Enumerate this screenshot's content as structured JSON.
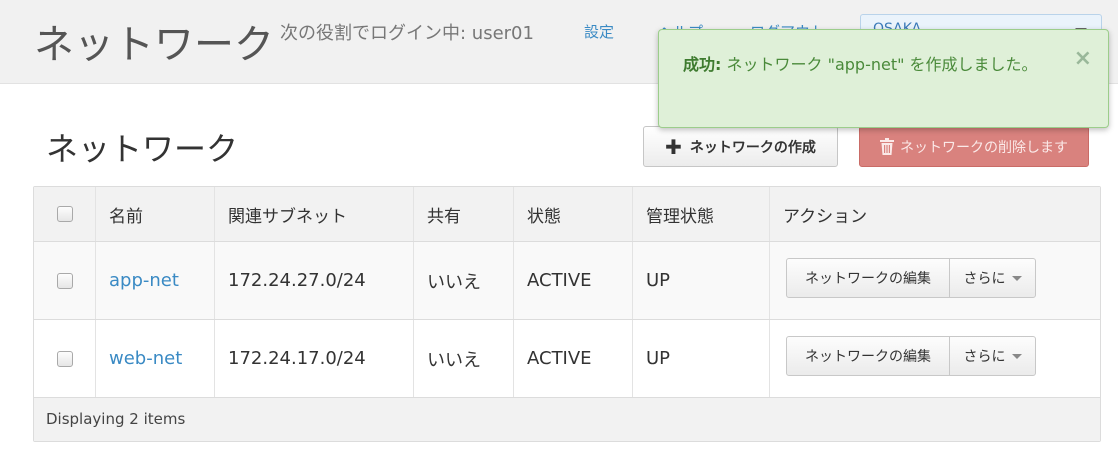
{
  "header": {
    "brand": "ネットワーク",
    "login_info": "次の役割でログイン中: user01",
    "links": {
      "settings": "設定",
      "help": "ヘルプ",
      "logout": "ログアウト"
    },
    "region": "OSAKA"
  },
  "page": {
    "title": "ネットワーク",
    "create_button": "ネットワークの作成",
    "delete_button": "ネットワークの削除します"
  },
  "table": {
    "columns": [
      "名前",
      "関連サブネット",
      "共有",
      "状態",
      "管理状態",
      "アクション"
    ],
    "rows": [
      {
        "name": "app-net",
        "subnet": "172.24.27.0/24",
        "shared": "いいえ",
        "status": "ACTIVE",
        "admin_state": "UP",
        "edit_label": "ネットワークの編集",
        "more_label": "さらに"
      },
      {
        "name": "web-net",
        "subnet": "172.24.17.0/24",
        "shared": "いいえ",
        "status": "ACTIVE",
        "admin_state": "UP",
        "edit_label": "ネットワークの編集",
        "more_label": "さらに"
      }
    ],
    "footer": "Displaying 2 items"
  },
  "toast": {
    "prefix": "成功:",
    "message": "ネットワーク \"app-net\" を作成しました。",
    "close": "×"
  },
  "colors": {
    "accent_link": "#3a8ac4",
    "danger": "#d9827e",
    "success_bg": "#dff0d8"
  },
  "icons": [
    "plus-icon",
    "trash-icon",
    "close-icon",
    "chevron-down-icon",
    "checkbox"
  ]
}
